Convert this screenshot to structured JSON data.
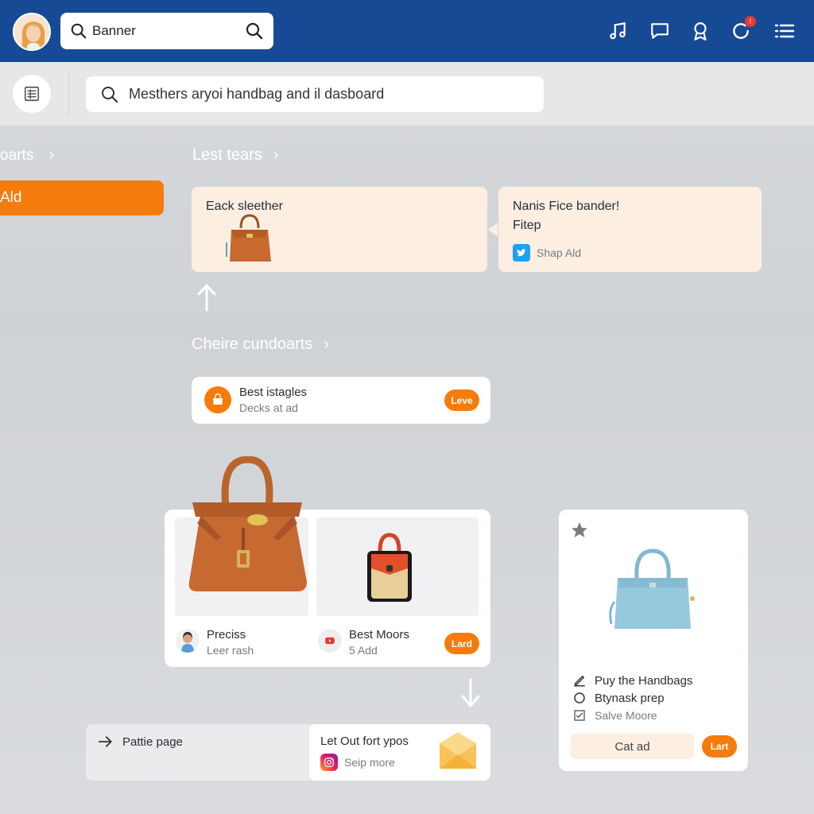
{
  "topbar": {
    "search_label": "Banner",
    "icons": [
      "music-icon",
      "chat-icon",
      "award-icon",
      "refresh-icon",
      "menu-icon"
    ],
    "notification_badge": "!"
  },
  "subbar": {
    "search_text": "Mesthers aryoi handbag and il dasboard"
  },
  "sidebar": {
    "crumb": "oarts",
    "active_item": "Ald"
  },
  "section1": {
    "title": "Lest tears",
    "card_left": {
      "title": "Eack sleether"
    },
    "card_right": {
      "line1": "Nanis Fice bander!",
      "line2": "Fitep",
      "link": "Shap Ald"
    }
  },
  "section2": {
    "title": "Cheire cundoarts",
    "item": {
      "title": "Best istagles",
      "subtitle": "Decks at ad",
      "button": "Leve"
    }
  },
  "products": {
    "left": {
      "title": "Preciss",
      "subtitle": "Leer rash"
    },
    "right": {
      "title": "Best Moors",
      "subtitle": "5 Add",
      "button": "Lard"
    }
  },
  "side_product": {
    "checklist": [
      "Puy the Handbags",
      "Btynask prep",
      "Salve Moore"
    ],
    "secondary_button": "Cat ad",
    "primary_button": "Lart"
  },
  "bottom": {
    "left_label": "Pattie page",
    "right_title": "Let Out fort ypos",
    "right_link": "Seip more"
  },
  "colors": {
    "topbar": "#174a94",
    "accent": "#f57c0c",
    "cream": "#fcefe2"
  }
}
